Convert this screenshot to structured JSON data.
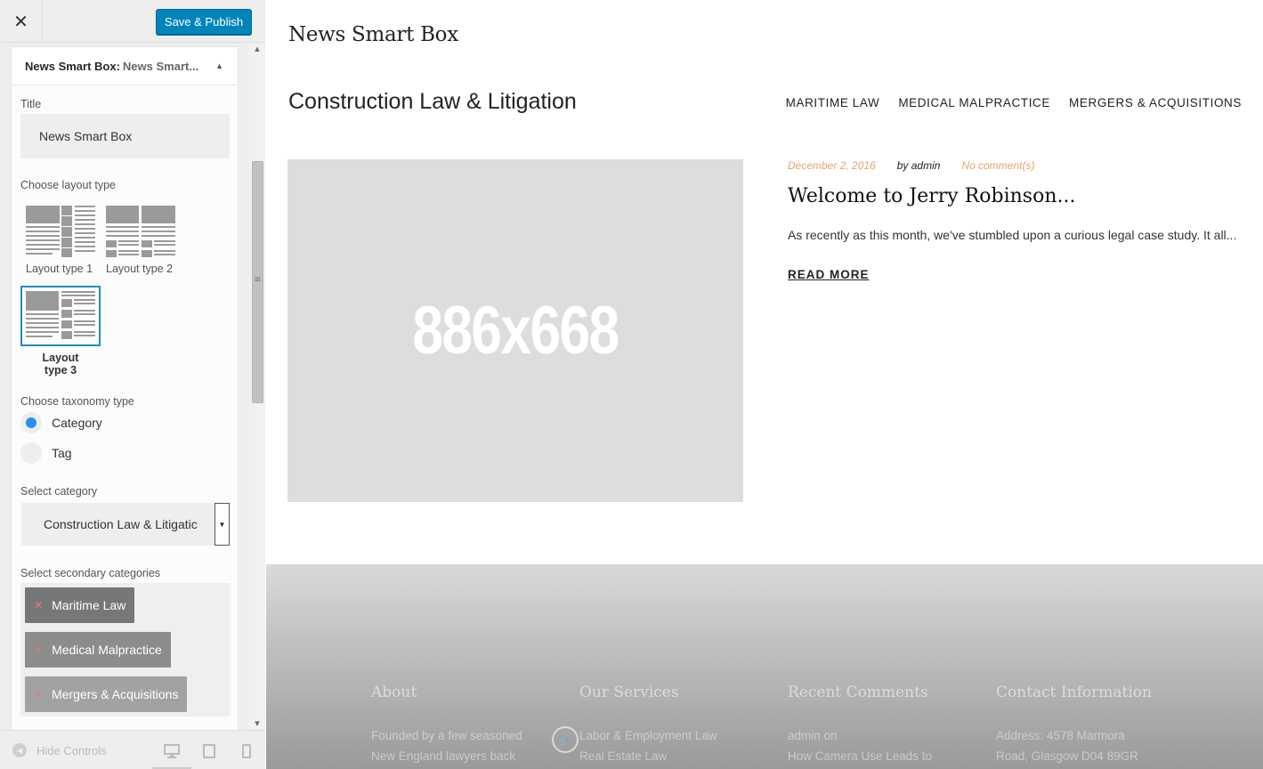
{
  "customizer": {
    "close_icon": "close-icon",
    "save_label": "Save & Publish",
    "widget": {
      "title_bold": "News Smart Box:",
      "title_sub": "News Smart...",
      "title_field_label": "Title",
      "title_field_value": "News Smart Box",
      "layout_label": "Choose layout type",
      "layouts": [
        {
          "label": "Layout type 1",
          "selected": false
        },
        {
          "label": "Layout type 2",
          "selected": false
        },
        {
          "label": "Layout type 3",
          "selected": true
        }
      ],
      "taxonomy_label": "Choose taxonomy type",
      "taxonomy_options": [
        {
          "label": "Category",
          "checked": true
        },
        {
          "label": "Tag",
          "checked": false
        }
      ],
      "category_label": "Select category",
      "category_value": "Construction Law & Litigatic",
      "secondary_label": "Select secondary categories",
      "secondary_categories": [
        "Maritime Law",
        "Medical Malpractice",
        "Mergers & Acquisitions"
      ]
    },
    "footer": {
      "hide_controls": "Hide Controls",
      "devices": [
        "desktop-icon",
        "tablet-icon",
        "mobile-icon"
      ]
    }
  },
  "preview": {
    "widget_title": "News Smart Box",
    "section_title": "Construction Law & Litigation",
    "section_nav": [
      "MARITIME LAW",
      "MEDICAL MALPRACTICE",
      "MERGERS & ACQUISITIONS"
    ],
    "thumbnail_text": "886x668",
    "post": {
      "date": "December 2, 2016",
      "author": "by admin",
      "comments": "No comment(s)",
      "title": "Welcome to Jerry Robinson...",
      "excerpt": "As recently as this month, we've stumbled upon a curious legal case study. It all...",
      "read_more": "READ MORE"
    },
    "footer": {
      "columns": [
        {
          "heading": "About",
          "lines": [
            "Founded by a few seasoned",
            "New England lawyers back"
          ]
        },
        {
          "heading": "Our Services",
          "lines": [
            "Labor & Employment Law",
            "Real Estate Law"
          ]
        },
        {
          "heading": "Recent Comments",
          "lines": [
            "admin on",
            "How Camera Use Leads to"
          ]
        },
        {
          "heading": "Contact Information",
          "lines": [
            "Address: 4578 Marmora",
            "Road, Glasgow D04 89GR"
          ]
        }
      ]
    }
  }
}
